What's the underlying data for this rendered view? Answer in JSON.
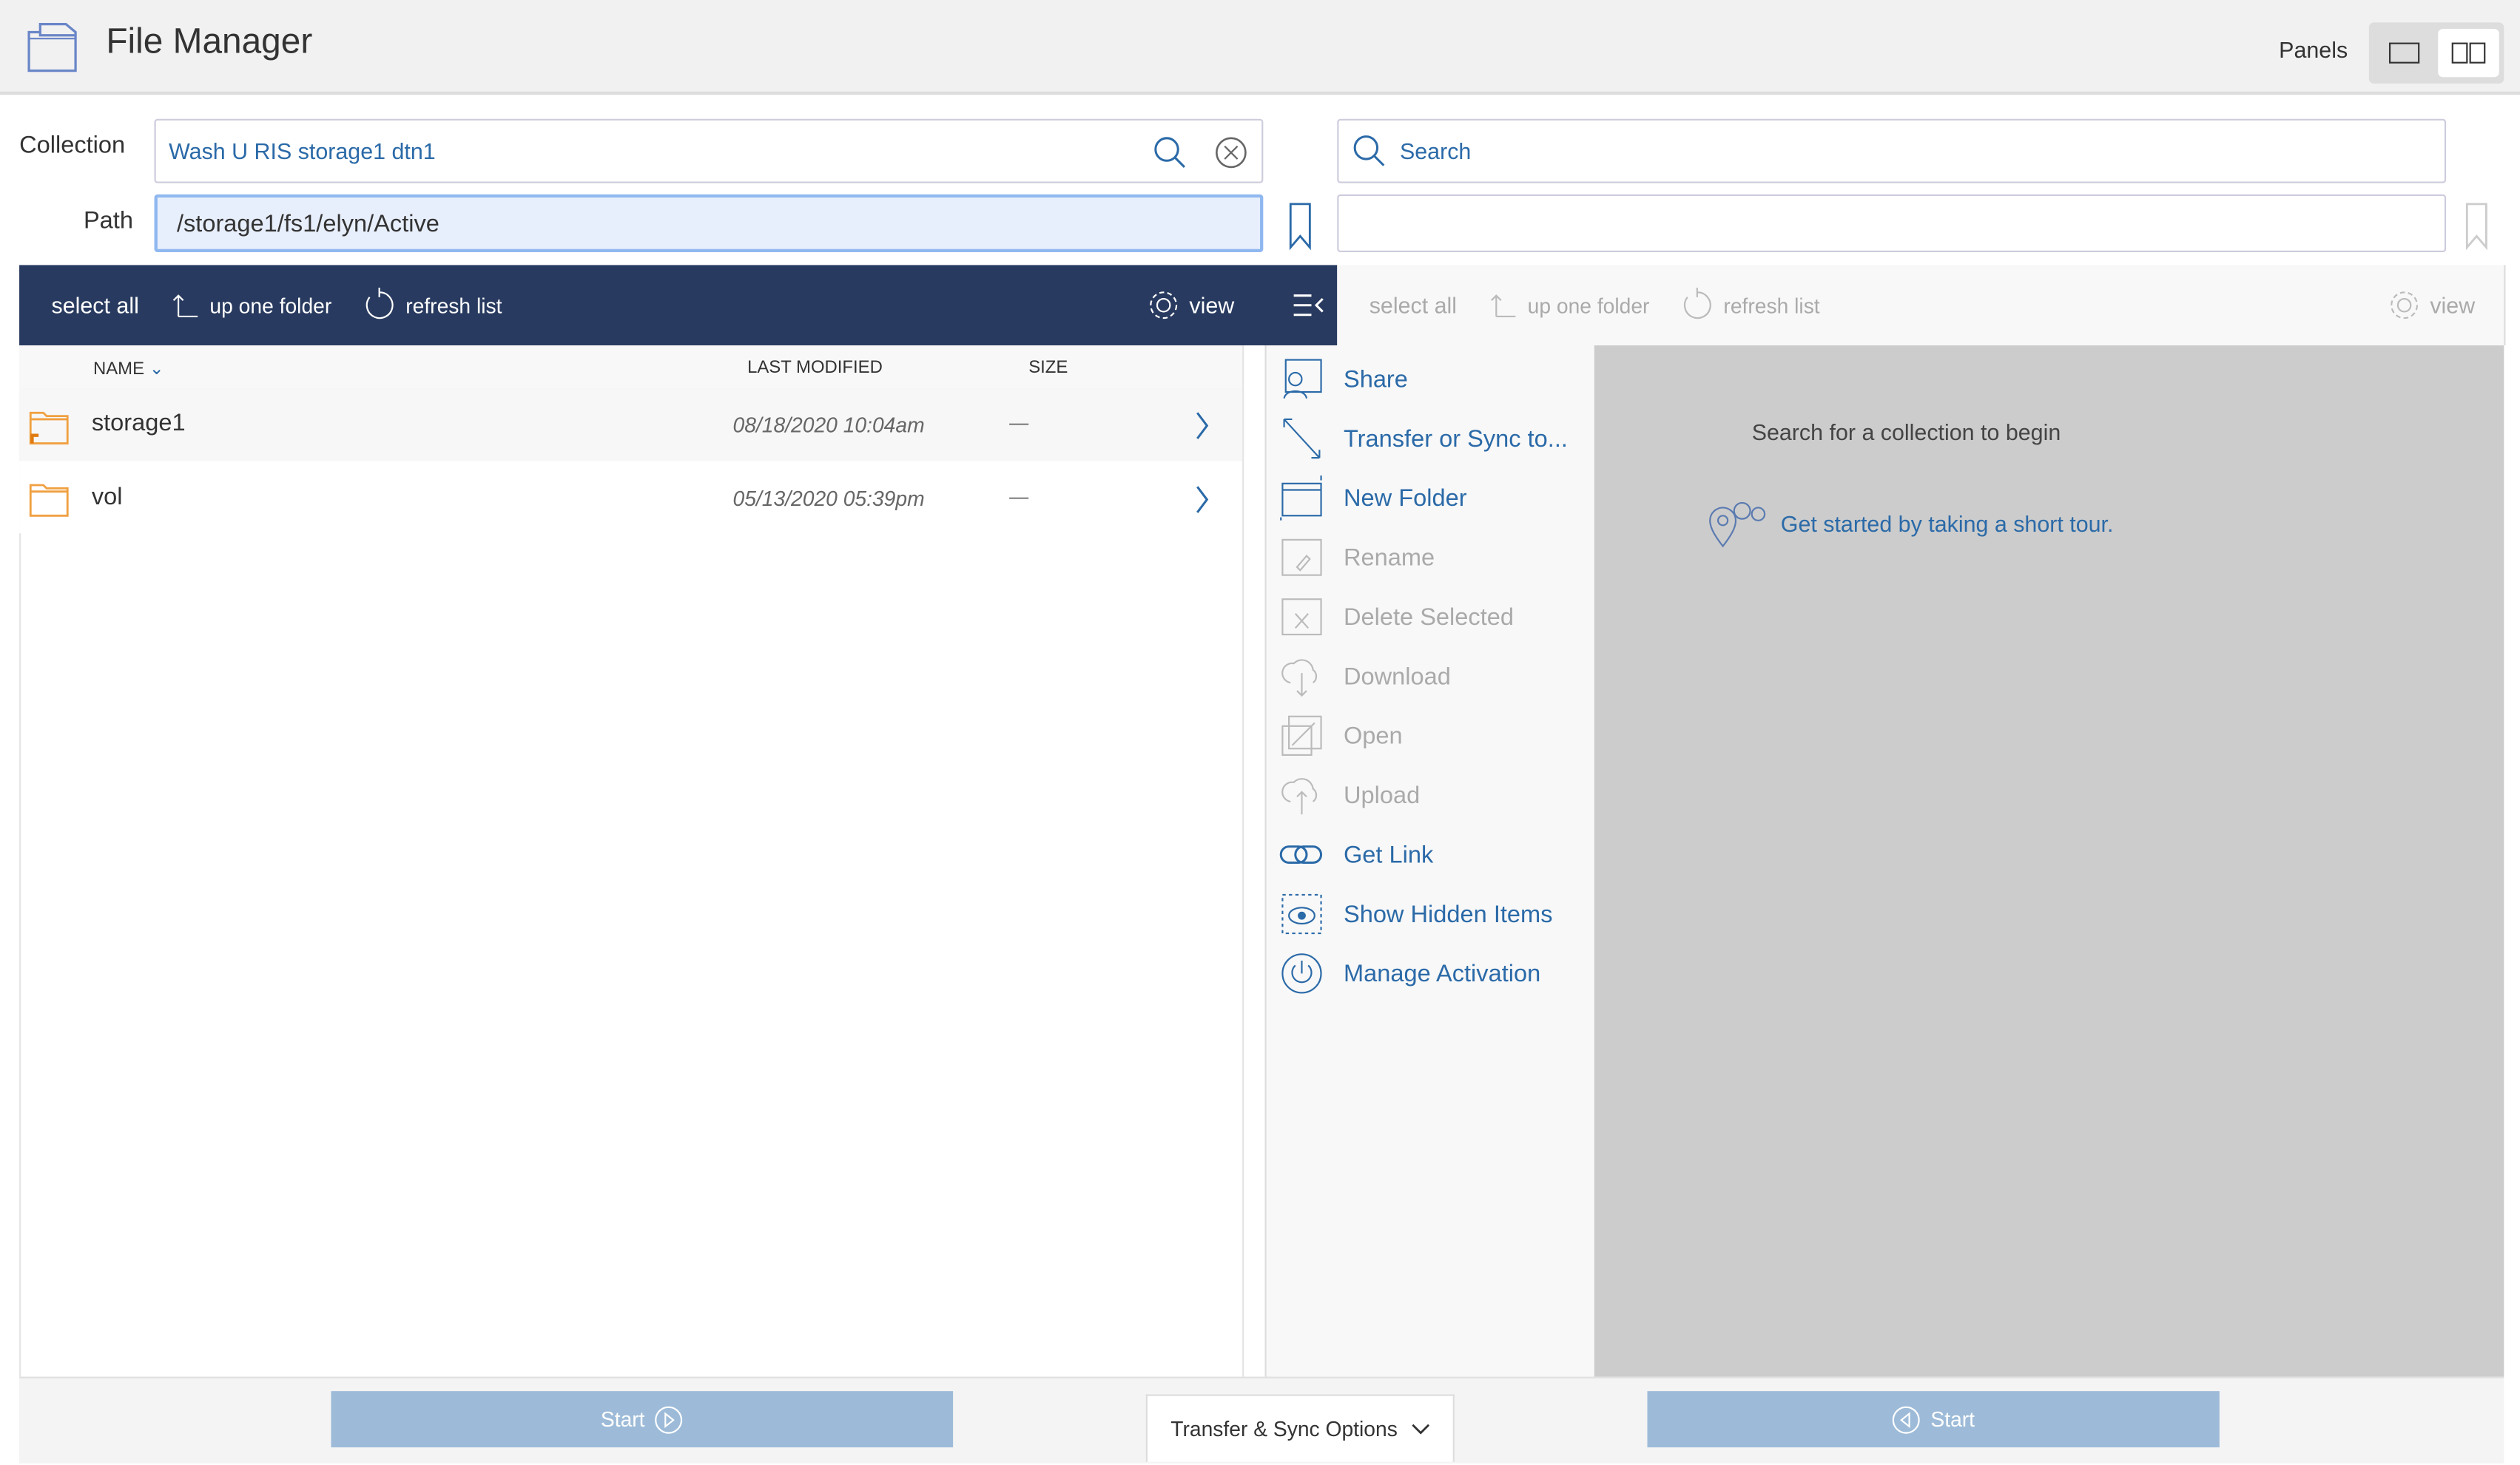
{
  "header": {
    "title": "File Manager",
    "panels_label": "Panels"
  },
  "left": {
    "collection_label": "Collection",
    "collection_value": "Wash U RIS storage1 dtn1",
    "path_label": "Path",
    "path_value": "/storage1/fs1/elyn/Active",
    "toolbar": {
      "select_all": "select all",
      "up_one_folder": "up one folder",
      "refresh_list": "refresh list",
      "view": "view"
    },
    "columns": {
      "name": "NAME",
      "last_modified": "LAST MODIFIED",
      "size": "SIZE"
    },
    "rows": [
      {
        "name": "storage1",
        "modified": "08/18/2020 10:04am",
        "size": "—"
      },
      {
        "name": "vol",
        "modified": "05/13/2020 05:39pm",
        "size": "—"
      }
    ]
  },
  "menu": {
    "items": [
      {
        "label": "Share",
        "enabled": true,
        "icon": "share-icon"
      },
      {
        "label": "Transfer or Sync to...",
        "enabled": true,
        "icon": "transfer-icon"
      },
      {
        "label": "New Folder",
        "enabled": true,
        "icon": "new-folder-icon"
      },
      {
        "label": "Rename",
        "enabled": false,
        "icon": "rename-icon"
      },
      {
        "label": "Delete Selected",
        "enabled": false,
        "icon": "delete-icon"
      },
      {
        "label": "Download",
        "enabled": false,
        "icon": "download-icon"
      },
      {
        "label": "Open",
        "enabled": false,
        "icon": "open-icon"
      },
      {
        "label": "Upload",
        "enabled": false,
        "icon": "upload-icon"
      },
      {
        "label": "Get Link",
        "enabled": true,
        "icon": "link-icon"
      },
      {
        "label": "Show Hidden Items",
        "enabled": true,
        "icon": "eye-icon"
      },
      {
        "label": "Manage Activation",
        "enabled": true,
        "icon": "power-icon"
      }
    ]
  },
  "right": {
    "search_placeholder": "Search",
    "toolbar": {
      "select_all": "select all",
      "up_one_folder": "up one folder",
      "refresh_list": "refresh list",
      "view": "view"
    },
    "empty_message": "Search for a collection to begin",
    "tour_link": "Get started by taking a short tour."
  },
  "footer": {
    "start_left": "Start",
    "start_right": "Start",
    "options": "Transfer & Sync Options"
  },
  "colors": {
    "toolbar": "#283a5f",
    "link": "#2b6aa8",
    "start": "#9dbbd8",
    "right_panel": "#cccccc"
  }
}
